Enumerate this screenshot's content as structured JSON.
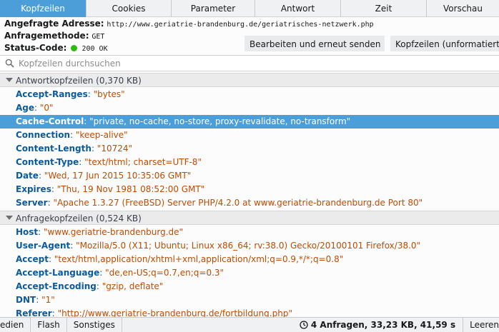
{
  "tabs": [
    {
      "label": "Kopfzeilen",
      "active": true
    },
    {
      "label": "Cookies"
    },
    {
      "label": "Parameter"
    },
    {
      "label": "Antwort"
    },
    {
      "label": "Zeit"
    },
    {
      "label": "Vorschau"
    }
  ],
  "summary": {
    "url_label": "Angefragte Adresse:",
    "url_value": "http://www.geriatrie-brandenburg.de/geriatrisches-netzwerk.php",
    "method_label": "Anfragemethode:",
    "method_value": "GET",
    "status_label": "Status-Code:",
    "status_value": "200 OK",
    "status_color": "#2cbb0f",
    "resend_button": "Bearbeiten und erneut senden",
    "raw_button": "Kopfzeilen (unformatiert)"
  },
  "filter": {
    "placeholder": "Kopfzeilen durchsuchen",
    "icon": "search-icon"
  },
  "response_section": {
    "title": "Antwortkopfzeilen (0,370 KB)",
    "headers": [
      {
        "key": "Accept-Ranges",
        "value": "\"bytes\""
      },
      {
        "key": "Age",
        "value": "\"0\""
      },
      {
        "key": "Cache-Control",
        "value": "\"private, no-cache, no-store, proxy-revalidate, no-transform\"",
        "selected": true
      },
      {
        "key": "Connection",
        "value": "\"keep-alive\""
      },
      {
        "key": "Content-Length",
        "value": "\"10724\""
      },
      {
        "key": "Content-Type",
        "value": "\"text/html; charset=UTF-8\""
      },
      {
        "key": "Date",
        "value": "\"Wed, 17 Jun 2015 10:35:06 GMT\""
      },
      {
        "key": "Expires",
        "value": "\"Thu, 19 Nov 1981 08:52:00 GMT\""
      },
      {
        "key": "Server",
        "value": "\"Apache 1.3.27 (FreeBSD) Server PHP/4.2.0 at www.geriatrie-brandenburg.de Port 80\""
      }
    ]
  },
  "request_section": {
    "title": "Anfragekopfzeilen (0,524 KB)",
    "headers": [
      {
        "key": "Host",
        "value": "\"www.geriatrie-brandenburg.de\""
      },
      {
        "key": "User-Agent",
        "value": "\"Mozilla/5.0 (X11; Ubuntu; Linux x86_64; rv:38.0) Gecko/20100101 Firefox/38.0\""
      },
      {
        "key": "Accept",
        "value": "\"text/html,application/xhtml+xml,application/xml;q=0.9,*/*;q=0.8\""
      },
      {
        "key": "Accept-Language",
        "value": "\"de,en-US;q=0.7,en;q=0.3\""
      },
      {
        "key": "Accept-Encoding",
        "value": "\"gzip, deflate\""
      },
      {
        "key": "DNT",
        "value": "\"1\""
      },
      {
        "key": "Referer",
        "value": "\"http://www.geriatrie-brandenburg.de/fortbildung.php\""
      }
    ]
  },
  "bottom_bar": {
    "items": [
      "edien",
      "Flash",
      "Sonstiges"
    ],
    "status_icon": "clock-icon",
    "status_text": "4 Anfragen, 33,23 KB, 41,59 s",
    "clear_button": "Leeren"
  }
}
